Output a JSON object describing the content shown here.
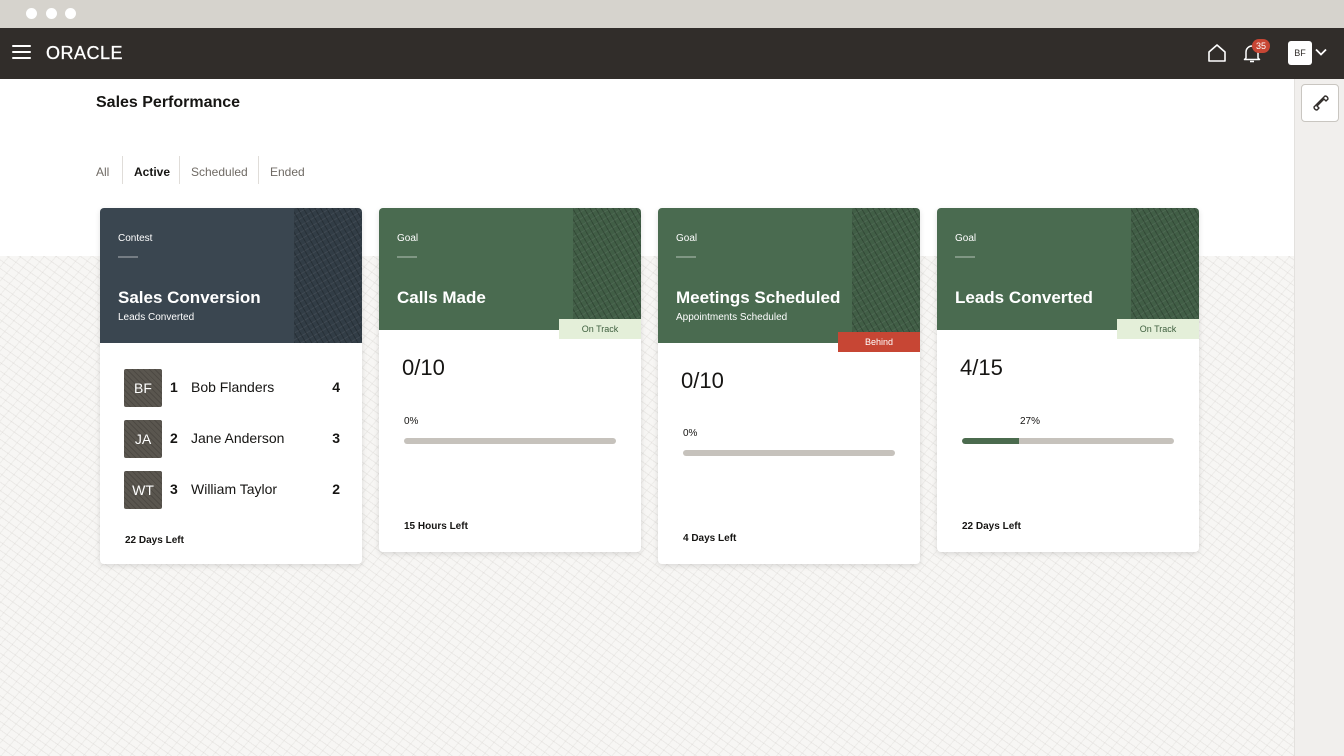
{
  "header": {
    "logo": "ORACLE",
    "notification_count": "35",
    "user_initials": "BF"
  },
  "page": {
    "title": "Sales Performance"
  },
  "tabs": [
    {
      "label": "All",
      "active": false
    },
    {
      "label": "Active",
      "active": true
    },
    {
      "label": "Scheduled",
      "active": false
    },
    {
      "label": "Ended",
      "active": false
    }
  ],
  "cards": {
    "contest": {
      "kind": "Contest",
      "title": "Sales Conversion",
      "subtitle": "Leads Converted",
      "head_color": "#3a4650",
      "leaders": [
        {
          "initials": "BF",
          "rank": "1",
          "name": "Bob Flanders",
          "score": "4"
        },
        {
          "initials": "JA",
          "rank": "2",
          "name": "Jane Anderson",
          "score": "3"
        },
        {
          "initials": "WT",
          "rank": "3",
          "name": "William Taylor",
          "score": "2"
        }
      ],
      "time_left": "22 Days Left"
    },
    "calls": {
      "kind": "Goal",
      "title": "Calls Made",
      "status": "On Track",
      "head_color": "#4a6b50",
      "progress": "0/10",
      "percent_label": "0%",
      "percent_value": 0,
      "time_left": "15 Hours Left"
    },
    "meetings": {
      "kind": "Goal",
      "title": "Meetings Scheduled",
      "subtitle": "Appointments Scheduled",
      "status": "Behind",
      "head_color": "#4a6b50",
      "progress": "0/10",
      "percent_label": "0%",
      "percent_value": 0,
      "time_left": "4 Days Left"
    },
    "leads": {
      "kind": "Goal",
      "title": "Leads Converted",
      "status": "On Track",
      "head_color": "#4a6b50",
      "progress": "4/15",
      "percent_label": "27%",
      "percent_value": 27,
      "time_left": "22 Days Left"
    }
  },
  "colors": {
    "header_bg": "#312d2a",
    "behind": "#c74634",
    "on_track_bg": "#e4efd9",
    "progress_fill": "#4b6b4e"
  }
}
